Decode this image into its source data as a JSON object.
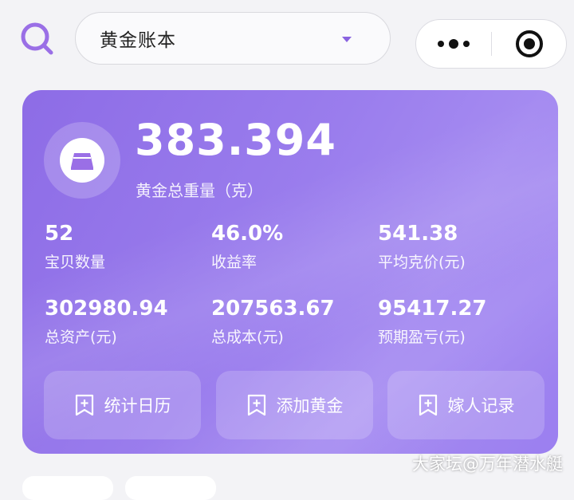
{
  "header": {
    "selector_title": "黄金账本",
    "accent_color": "#8a63e0"
  },
  "summary": {
    "total_weight": "383.394",
    "total_weight_label": "黄金总重量（克）",
    "stats": [
      {
        "value": "52",
        "label": "宝贝数量"
      },
      {
        "value": "46.0%",
        "label": "收益率"
      },
      {
        "value": "541.38",
        "label": "平均克价(元)"
      },
      {
        "value": "302980.94",
        "label": "总资产(元)"
      },
      {
        "value": "207563.67",
        "label": "总成本(元)"
      },
      {
        "value": "95417.27",
        "label": "预期盈亏(元)"
      }
    ]
  },
  "actions": [
    {
      "label": "统计日历",
      "icon": "bookmark-plus-icon"
    },
    {
      "label": "添加黄金",
      "icon": "bookmark-plus-icon"
    },
    {
      "label": "嫁人记录",
      "icon": "bookmark-plus-icon"
    }
  ],
  "watermark": "大家坛@万年潜水艇"
}
